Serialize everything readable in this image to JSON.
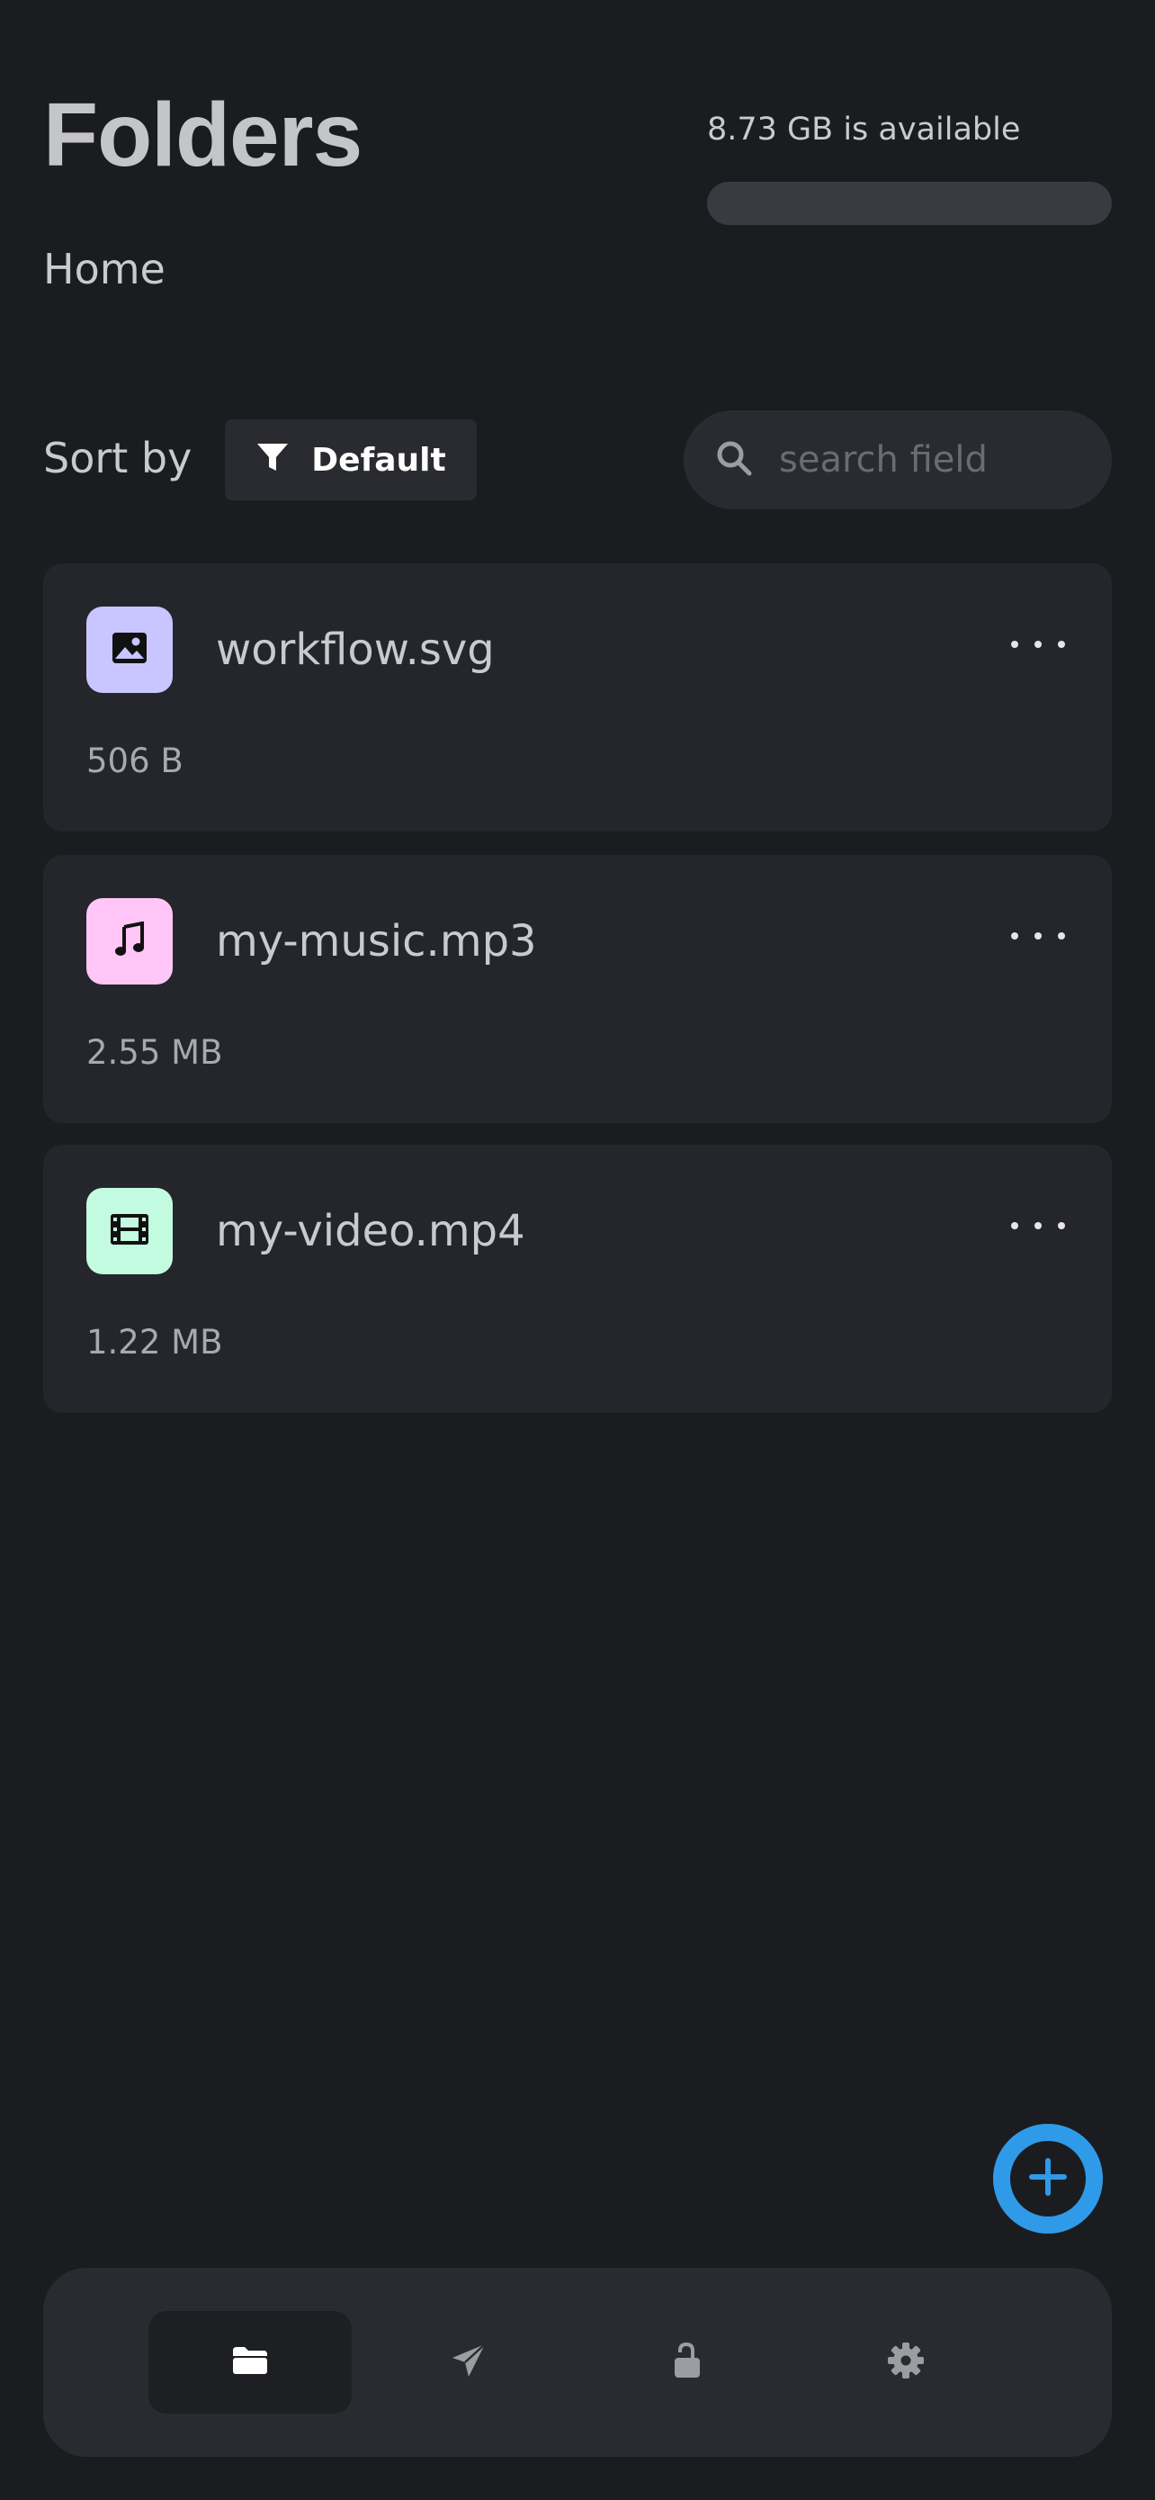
{
  "header": {
    "title": "Folders",
    "breadcrumb": "Home"
  },
  "storage": {
    "available_text": "8.73 GB is available",
    "used_fraction": 0
  },
  "toolbar": {
    "sort_label": "Sort by",
    "sort_value": "Default",
    "search_placeholder": "search field"
  },
  "files": [
    {
      "name": "workflow.svg",
      "size": "506 B",
      "icon": "image-icon",
      "icon_bg": "#c9c6ff"
    },
    {
      "name": "my-music.mp3",
      "size": "2.55 MB",
      "icon": "music-note-icon",
      "icon_bg": "#ffc6f7"
    },
    {
      "name": "my-video.mp4",
      "size": "1.22 MB",
      "icon": "film-icon",
      "icon_bg": "#c3fbe0"
    }
  ],
  "colors": {
    "background": "#1b1c20",
    "card": "#25262b",
    "accent": "#2f9be8"
  },
  "bottom_nav": {
    "items": [
      {
        "icon": "folder-icon",
        "active": true
      },
      {
        "icon": "send-icon",
        "active": false
      },
      {
        "icon": "unlock-icon",
        "active": false
      },
      {
        "icon": "gear-icon",
        "active": false
      }
    ]
  }
}
